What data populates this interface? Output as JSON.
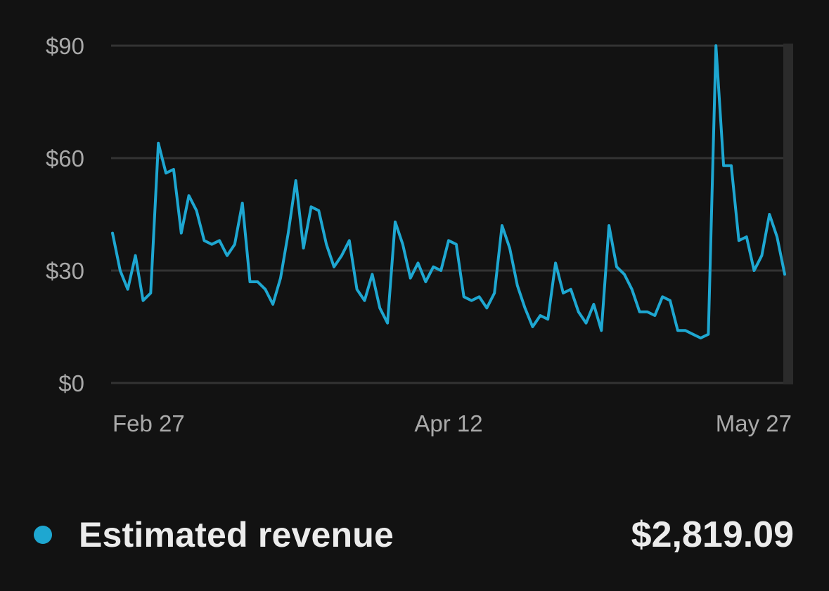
{
  "chart_data": {
    "type": "line",
    "x_tick_labels": [
      "Feb 27",
      "Apr 12",
      "May 27"
    ],
    "y_tick_labels": [
      "$90",
      "$60",
      "$30",
      "$0"
    ],
    "y_ticks": [
      90,
      60,
      30,
      0
    ],
    "ylim": [
      0,
      90
    ],
    "grid": true,
    "series": [
      {
        "name": "Estimated revenue",
        "color": "#1ea7d1",
        "values": [
          40,
          30,
          25,
          34,
          22,
          24,
          64,
          56,
          57,
          40,
          50,
          46,
          38,
          37,
          38,
          34,
          37,
          48,
          27,
          27,
          25,
          21,
          28,
          40,
          54,
          36,
          47,
          46,
          37,
          31,
          34,
          38,
          25,
          22,
          29,
          20,
          16,
          43,
          37,
          28,
          32,
          27,
          31,
          30,
          38,
          37,
          23,
          22,
          23,
          20,
          24,
          42,
          36,
          26,
          20,
          15,
          18,
          17,
          32,
          24,
          25,
          19,
          16,
          21,
          14,
          42,
          31,
          29,
          25,
          19,
          19,
          18,
          23,
          22,
          14,
          14,
          13,
          12,
          13,
          90,
          58,
          58,
          38,
          39,
          30,
          34,
          45,
          39,
          29
        ]
      }
    ]
  },
  "legend": {
    "label": "Estimated revenue",
    "total": "$2,819.09",
    "dot_color": "#1ea7d1"
  }
}
